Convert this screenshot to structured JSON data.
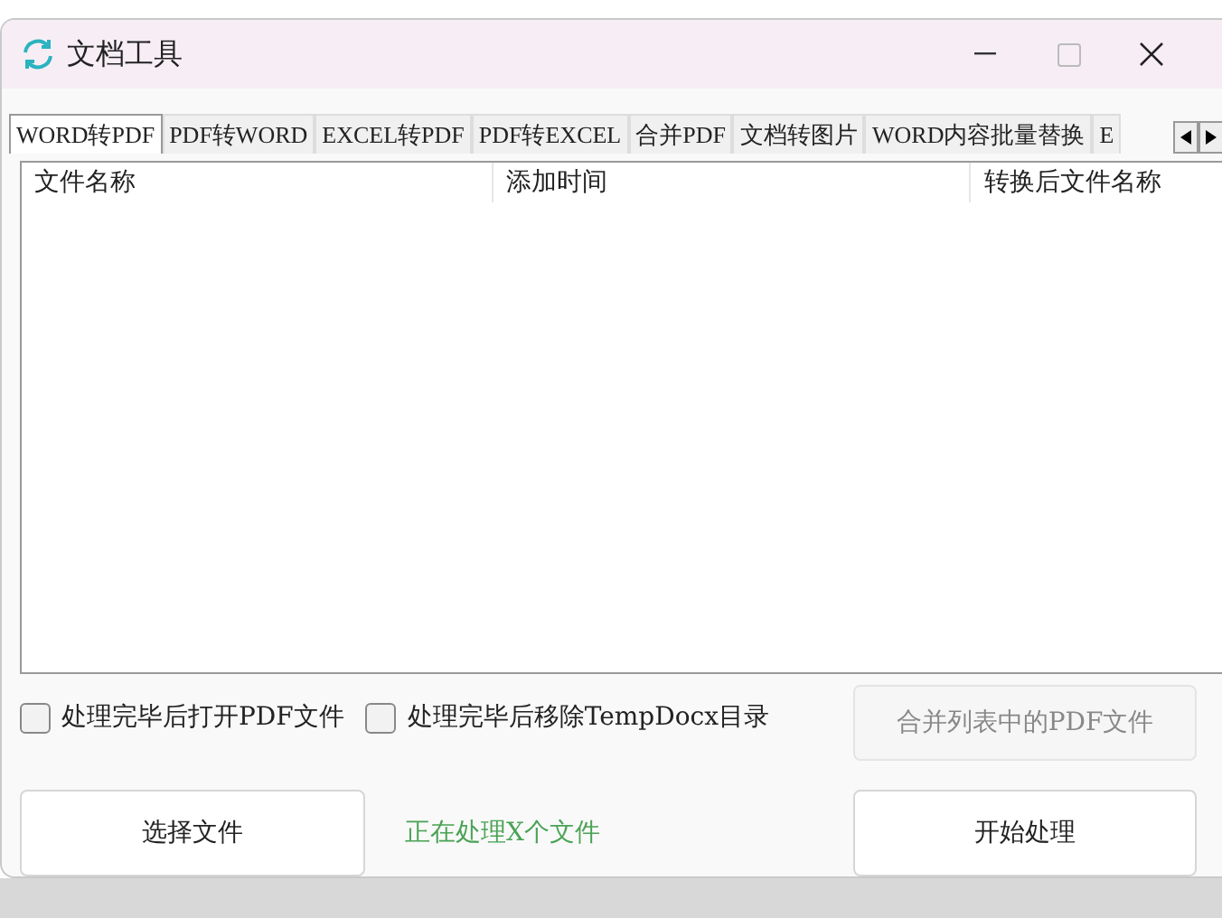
{
  "window": {
    "title": "文档工具"
  },
  "tabs": [
    {
      "label": "WORD转PDF",
      "selected": true
    },
    {
      "label": "PDF转WORD",
      "selected": false
    },
    {
      "label": "EXCEL转PDF",
      "selected": false
    },
    {
      "label": "PDF转EXCEL",
      "selected": false
    },
    {
      "label": "合并PDF",
      "selected": false
    },
    {
      "label": "文档转图片",
      "selected": false
    },
    {
      "label": "WORD内容批量替换",
      "selected": false
    },
    {
      "label": "E",
      "selected": false
    }
  ],
  "table": {
    "columns": [
      "文件名称",
      "添加时间",
      "转换后文件名称"
    ]
  },
  "options": [
    {
      "label": "处理完毕后打开PDF文件",
      "checked": false
    },
    {
      "label": "处理完毕后移除TempDocx目录",
      "checked": false
    }
  ],
  "merge_button": {
    "label": "合并列表中的PDF文件",
    "disabled": true
  },
  "select_button": {
    "label": "选择文件",
    "disabled": false
  },
  "status": "正在处理X个文件",
  "start_button": {
    "label": "开始处理",
    "disabled": false
  }
}
